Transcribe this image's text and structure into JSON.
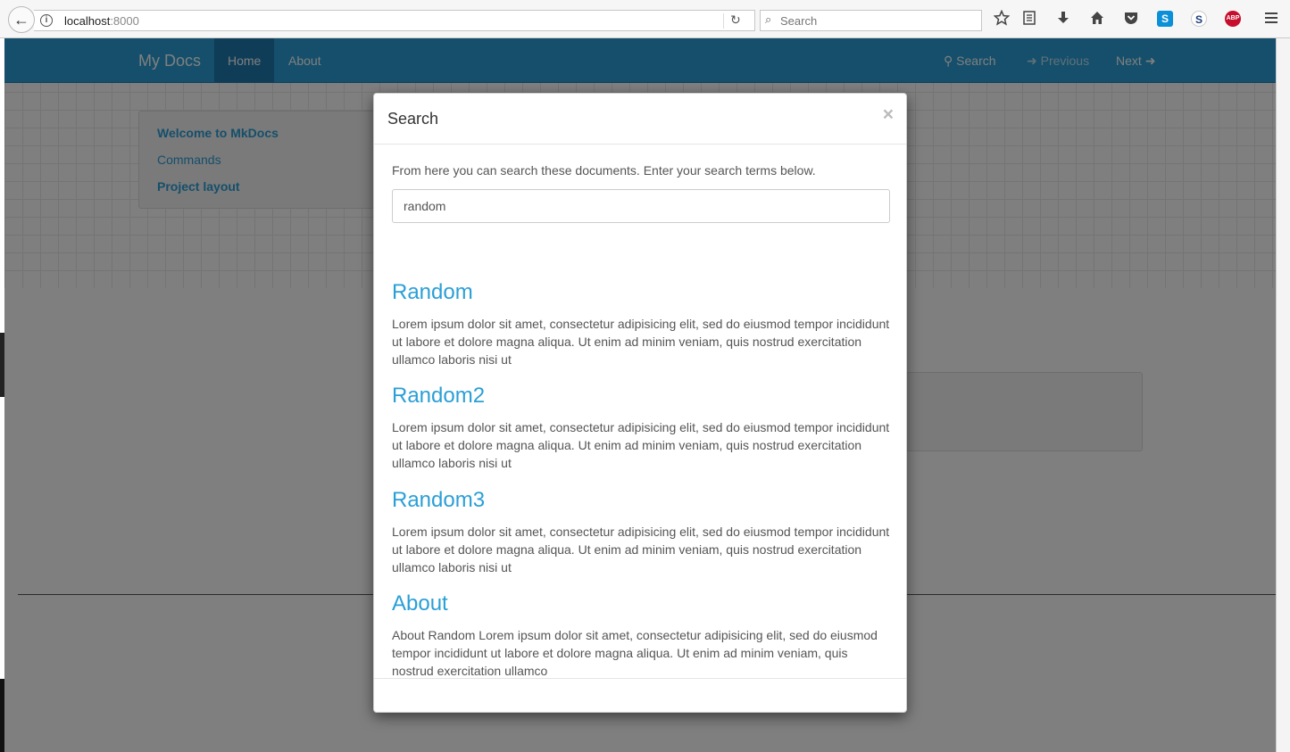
{
  "browser": {
    "url_host": "localhost",
    "url_port": ":8000",
    "search_placeholder": "Search",
    "info_icon": "i",
    "back_icon": "←",
    "reload_icon": "↻",
    "search_glyph": "⌕",
    "toolbar_icons": [
      "star-icon",
      "reading-list-icon",
      "download-icon",
      "home-icon",
      "pocket-icon",
      "skype-icon",
      "s-extension-icon",
      "adblock-icon",
      "menu-icon"
    ],
    "skype_glyph": "S",
    "s_ext_glyph": "S",
    "abp_label": "ABP"
  },
  "navbar": {
    "brand": "My Docs",
    "items": [
      {
        "label": "Home",
        "active": true
      },
      {
        "label": "About",
        "active": false
      }
    ],
    "search_label": "Search",
    "previous_label": "Previous",
    "next_label": "Next",
    "accent_color": "#2a9fd6"
  },
  "sidebar": {
    "items": [
      {
        "label": "Welcome to MkDocs"
      },
      {
        "label": "Commands"
      },
      {
        "label": "Project layout"
      }
    ]
  },
  "modal": {
    "title": "Search",
    "close_label": "×",
    "intro": "From here you can search these documents. Enter your search terms below.",
    "search_value": "random",
    "results": [
      {
        "title": "Random",
        "text": "Lorem ipsum dolor sit amet, consectetur adipisicing elit, sed do eiusmod tempor incididunt ut labore et dolore magna aliqua. Ut enim ad minim veniam, quis nostrud exercitation ullamco laboris nisi ut"
      },
      {
        "title": "Random2",
        "text": "Lorem ipsum dolor sit amet, consectetur adipisicing elit, sed do eiusmod tempor incididunt ut labore et dolore magna aliqua. Ut enim ad minim veniam, quis nostrud exercitation ullamco laboris nisi ut"
      },
      {
        "title": "Random3",
        "text": "Lorem ipsum dolor sit amet, consectetur adipisicing elit, sed do eiusmod tempor incididunt ut labore et dolore magna aliqua. Ut enim ad minim veniam, quis nostrud exercitation ullamco laboris nisi ut"
      },
      {
        "title": "About",
        "text": "About Random Lorem ipsum dolor sit amet, consectetur adipisicing elit, sed do eiusmod tempor incididunt ut labore et dolore magna aliqua. Ut enim ad minim veniam, quis nostrud exercitation ullamco"
      }
    ]
  }
}
